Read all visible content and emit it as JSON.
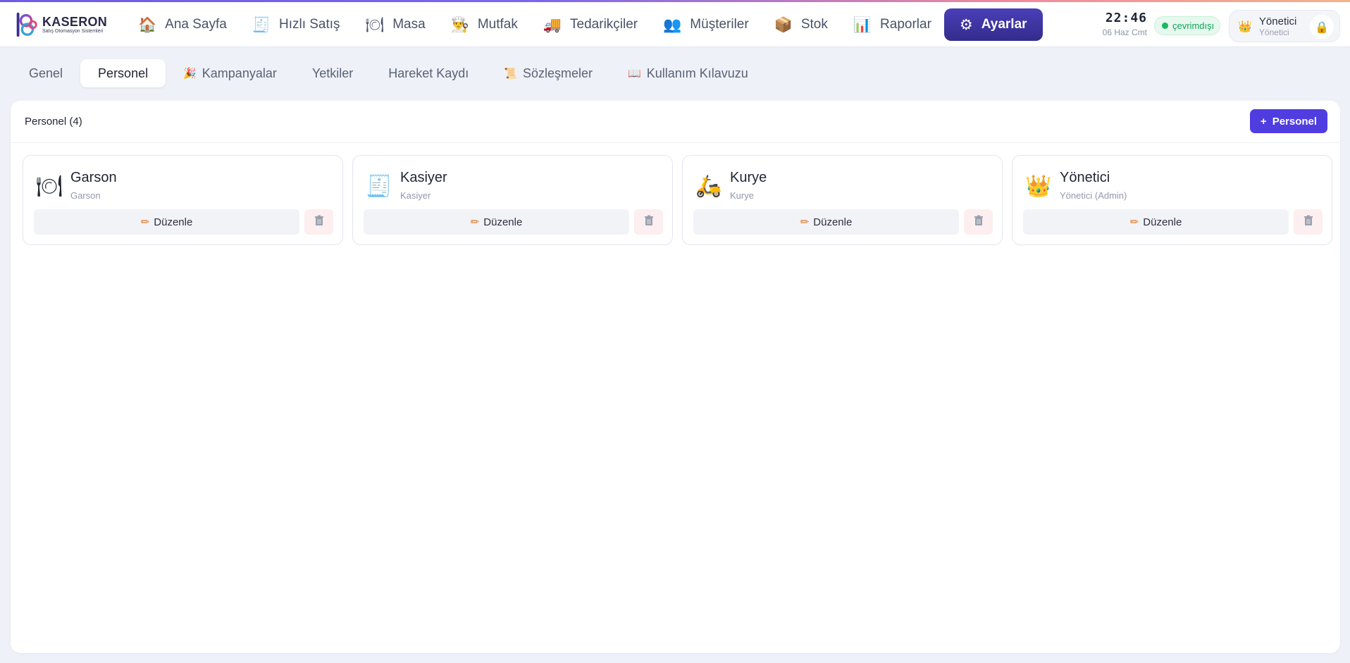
{
  "brand": {
    "name": "KASERON",
    "tagline": "Satış Otomasyon Sistemleri"
  },
  "nav": [
    {
      "label": "Ana Sayfa",
      "icon": "🏠",
      "icon_name": "home-icon"
    },
    {
      "label": "Hızlı Satış",
      "icon": "🧾",
      "icon_name": "receipt-icon"
    },
    {
      "label": "Masa",
      "icon": "🍽",
      "icon_name": "plate-icon"
    },
    {
      "label": "Mutfak",
      "icon": "👨‍🍳",
      "icon_name": "chef-icon"
    },
    {
      "label": "Tedarikçiler",
      "icon": "🚚",
      "icon_name": "truck-icon"
    },
    {
      "label": "Müşteriler",
      "icon": "👥",
      "icon_name": "users-icon"
    },
    {
      "label": "Stok",
      "icon": "📦",
      "icon_name": "box-icon"
    },
    {
      "label": "Raporlar",
      "icon": "📊",
      "icon_name": "chart-icon"
    },
    {
      "label": "Ayarlar",
      "icon": "⚙",
      "icon_name": "gear-icon",
      "active": true
    }
  ],
  "clock": {
    "time": "22:46",
    "date": "06 Haz Cmt"
  },
  "status": {
    "label": "çevrimdışı",
    "color": "#17b862"
  },
  "user": {
    "name": "Yönetici",
    "role": "Yönetici",
    "crown_icon": "👑",
    "lock_icon": "🔒"
  },
  "tabs": [
    {
      "label": "Genel",
      "icon": ""
    },
    {
      "label": "Personel",
      "icon": "",
      "active": true
    },
    {
      "label": "Kampanyalar",
      "icon": "🎉"
    },
    {
      "label": "Yetkiler",
      "icon": ""
    },
    {
      "label": "Hareket Kaydı",
      "icon": ""
    },
    {
      "label": "Sözleşmeler",
      "icon": "📜"
    },
    {
      "label": "Kullanım Kılavuzu",
      "icon": "📖"
    }
  ],
  "panel": {
    "title": "Personel (4)",
    "add_button": {
      "plus": "+",
      "label": "Personel"
    },
    "cards": [
      {
        "name": "Garson",
        "role": "Garson",
        "icon": "🍽",
        "edit_label": "Düzenle"
      },
      {
        "name": "Kasiyer",
        "role": "Kasiyer",
        "icon": "🧾",
        "edit_label": "Düzenle"
      },
      {
        "name": "Kurye",
        "role": "Kurye",
        "icon": "🛵",
        "edit_label": "Düzenle"
      },
      {
        "name": "Yönetici",
        "role": "Yönetici (Admin)",
        "icon": "👑",
        "edit_label": "Düzenle"
      }
    ]
  },
  "colors": {
    "accent": "#4f3de0",
    "active_nav": "#3f37a6",
    "delete_bg": "#fdeef0"
  }
}
